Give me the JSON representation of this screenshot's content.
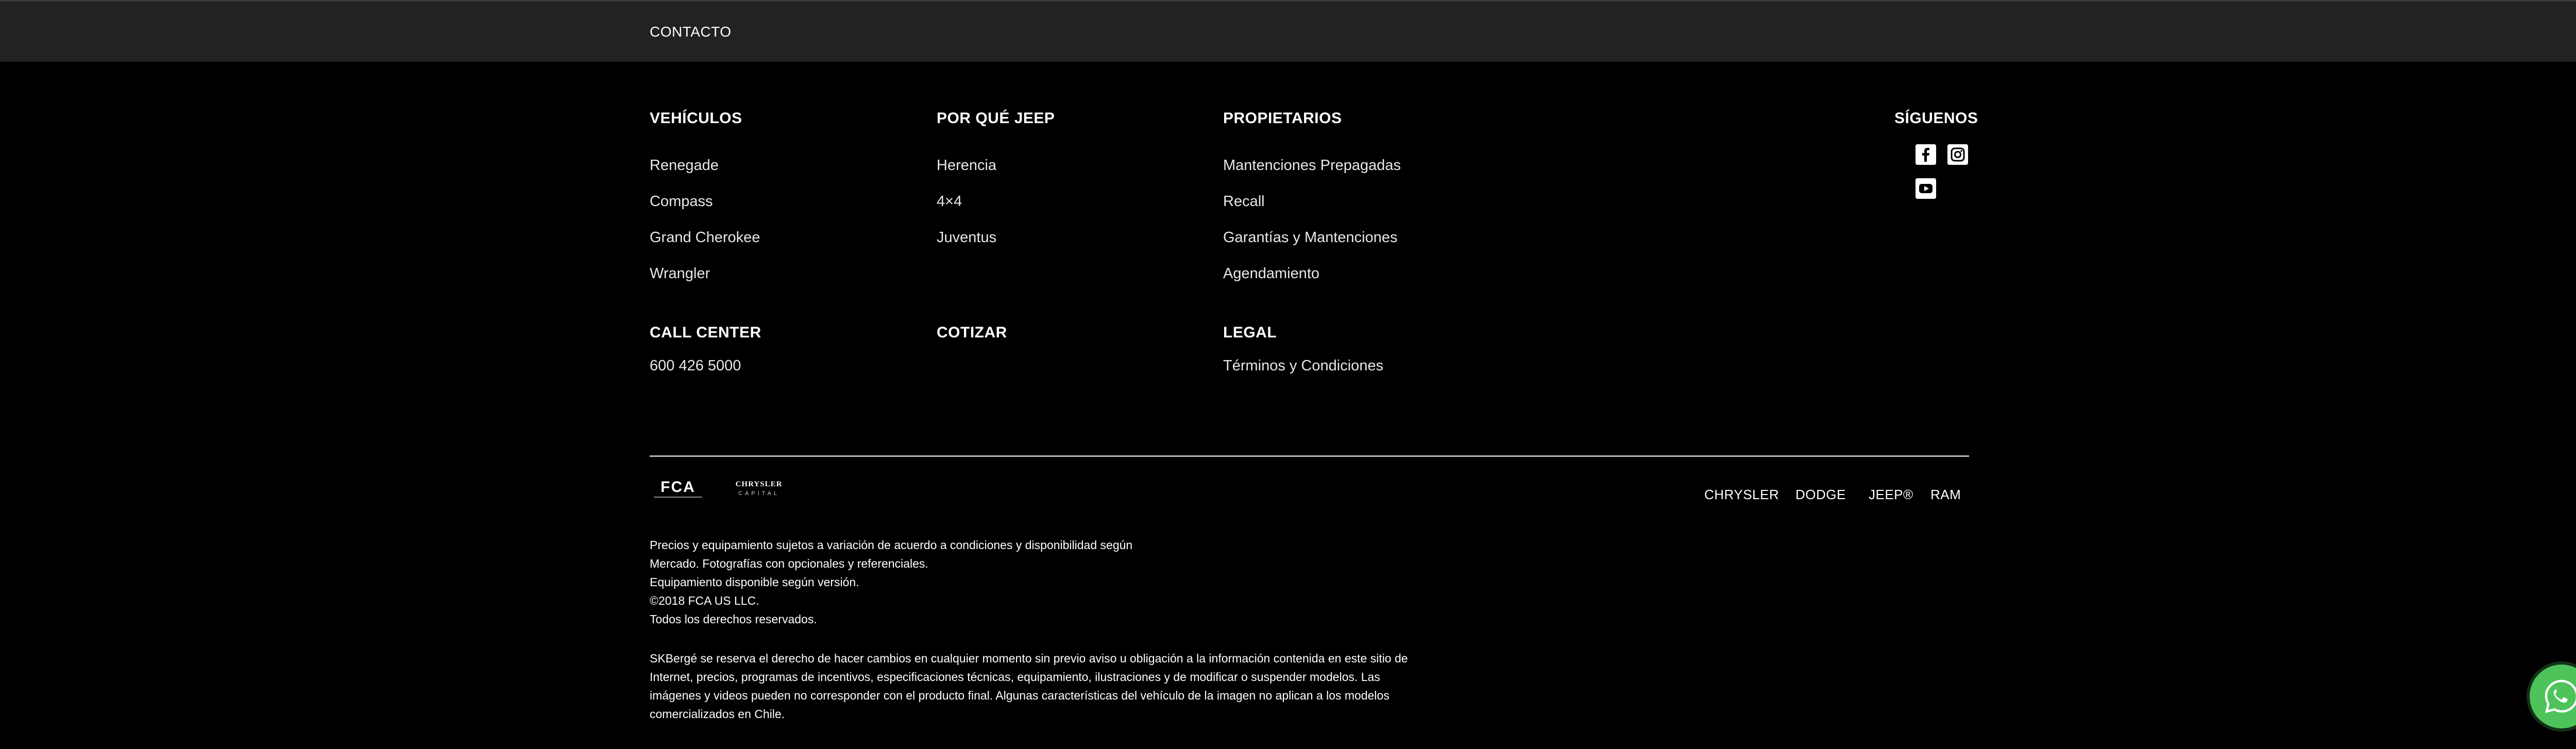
{
  "topbar": {
    "contact_label": "CONTACTO"
  },
  "columns": [
    {
      "heading": "VEHÍCULOS",
      "links": [
        "Renegade",
        "Compass",
        "Grand Cherokee",
        "Wrangler"
      ]
    },
    {
      "heading": "POR QUÉ JEEP",
      "links": [
        "Herencia",
        "4×4",
        "Juventus"
      ]
    },
    {
      "heading": "PROPIETARIOS",
      "links": [
        "Mantenciones Prepagadas",
        "Recall",
        "Garantías y Mantenciones",
        "Agendamiento"
      ]
    }
  ],
  "call_center": {
    "heading": "CALL CENTER",
    "phone": "600 426 5000"
  },
  "cotizar": {
    "heading": "COTIZAR"
  },
  "legal": {
    "heading": "LEGAL",
    "terms": "Términos y Condiciones"
  },
  "social": {
    "heading": "SÍGUENOS",
    "icons": [
      "facebook-icon",
      "instagram-icon",
      "youtube-icon"
    ]
  },
  "logos": {
    "fca": "FCA",
    "chrysler_capital": [
      "CHRYSLER",
      "CAPITAL"
    ]
  },
  "brands": [
    "CHRYSLER",
    "DODGE",
    "JEEP®",
    "RAM"
  ],
  "disclaimer": {
    "lines": [
      "Precios y equipamiento sujetos a variación de acuerdo a condiciones y disponibilidad según",
      "Mercado. Fotografías con opcionales y referenciales.",
      "Equipamiento disponible según versión.",
      "©2018 FCA US LLC.",
      "Todos los derechos reservados."
    ],
    "notice_lines": [
      "SKBergé se reserva el derecho de hacer cambios en cualquier momento sin previo aviso u obligación a la información contenida en este sitio de",
      "Internet, precios, programas de incentivos, especificaciones técnicas, equipamiento, ilustraciones y de modificar o suspender modelos. Las",
      "imágenes y videos pueden no corresponder con el producto final. Algunas características del vehículo de la imagen no aplican a los modelos",
      "comercializados en Chile."
    ]
  },
  "whatsapp": {
    "icon": "whatsapp-icon"
  },
  "colors": {
    "background": "#000000",
    "topbar": "#222222",
    "whatsapp": "#4dc35a"
  }
}
